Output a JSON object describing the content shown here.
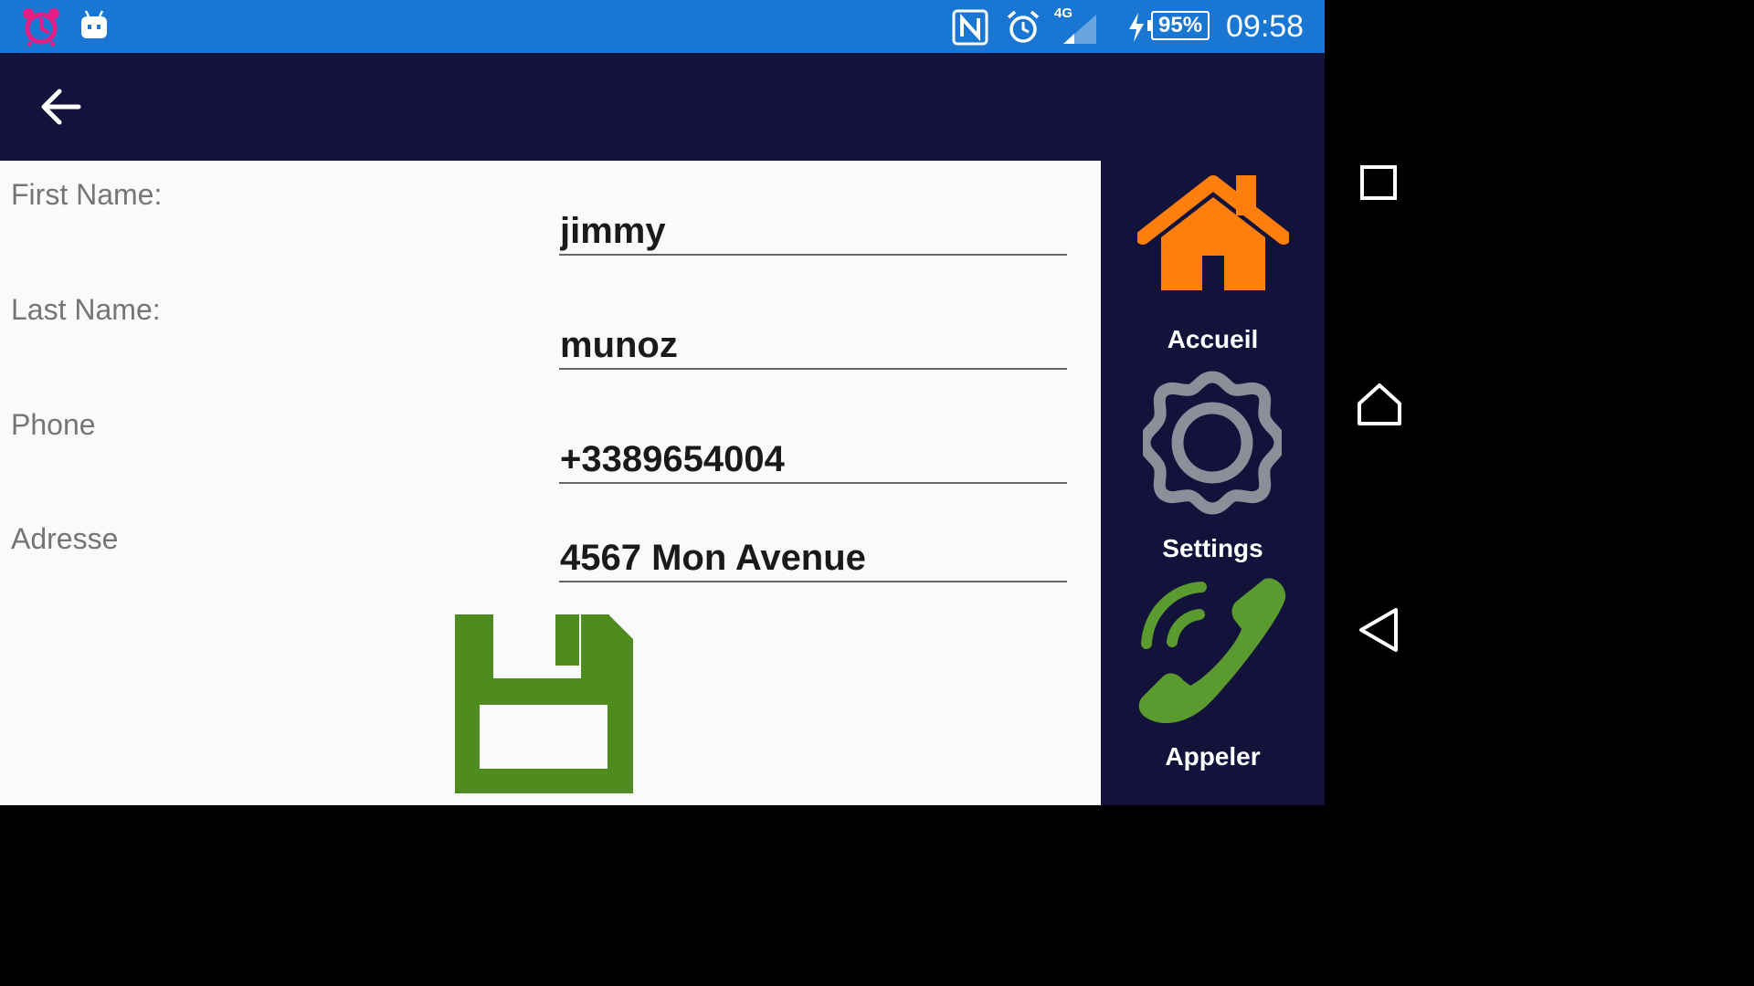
{
  "status_bar": {
    "network_type": "4G",
    "battery": "95%",
    "time": "09:58",
    "icons": [
      "alarm-clock-icon",
      "android-debug-icon",
      "nfc-icon",
      "alarm-icon",
      "signal-icon",
      "charging-icon",
      "battery-icon"
    ]
  },
  "app_bar": {
    "back_icon": "arrow-back-icon"
  },
  "form": {
    "first_name_label": "First Name:",
    "first_name_value": "jimmy",
    "last_name_label": "Last Name:",
    "last_name_value": "munoz",
    "phone_label": "Phone",
    "phone_value": "+3389654004",
    "address_label": "Adresse",
    "address_value": "4567 Mon Avenue",
    "save_icon": "floppy-disk-icon"
  },
  "side_nav": {
    "items": [
      {
        "label": "Accueil",
        "icon": "home-icon"
      },
      {
        "label": "Settings",
        "icon": "gear-icon"
      },
      {
        "label": "Appeler",
        "icon": "phone-call-icon"
      }
    ]
  },
  "system_nav": {
    "icons": [
      "recents-square-icon",
      "home-outline-icon",
      "back-triangle-icon"
    ]
  },
  "colors": {
    "status_bar": "#1976d2",
    "app_bar": "#12123a",
    "home_icon": "#ff7f0e",
    "gear_icon": "#8a8f99",
    "phone_icon": "#5b9a2f",
    "save_icon": "#4e8c1f",
    "alarm_pink": "#e91e84"
  }
}
